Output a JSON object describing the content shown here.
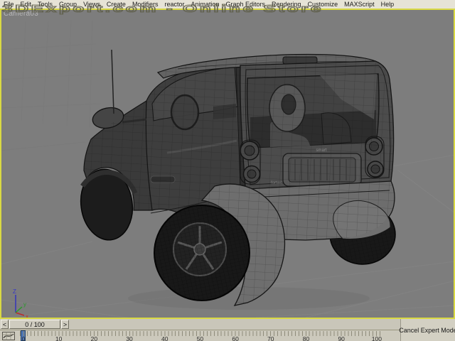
{
  "menu": {
    "items": [
      "File",
      "Edit",
      "Tools",
      "Group",
      "Views",
      "Create",
      "Modifiers",
      "reactor",
      "Animation",
      "Graph Editors",
      "Rendering",
      "Customize",
      "MAXScript",
      "Help"
    ]
  },
  "watermark": {
    "text": "3DExport.com - Online Store"
  },
  "viewport": {
    "label": "Camera03"
  },
  "axis": {
    "x": "x",
    "y": "y",
    "z": "Z"
  },
  "car": {
    "badge": "smart",
    "model_text": "fortwo"
  },
  "timeline": {
    "prev_label": "<",
    "thumb_label": "0 / 100",
    "next_label": ">",
    "current_frame": "0",
    "tick_labels": [
      "0",
      "10",
      "20",
      "30",
      "40",
      "50",
      "60",
      "70",
      "80",
      "90",
      "100"
    ]
  },
  "expert_button": {
    "label": "Cancel Expert Mode"
  },
  "ui_colors": {
    "viewport_border": "#d9d943",
    "viewport_bg": "#7d7d7d",
    "frame_marker": "#4f77b5",
    "menubar_bg": "#e6e3d6"
  }
}
